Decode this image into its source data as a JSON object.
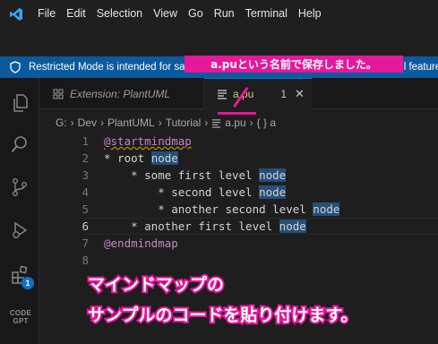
{
  "menubar": {
    "logo_icon": "vscode-logo-icon",
    "items": [
      "File",
      "Edit",
      "Selection",
      "View",
      "Go",
      "Run",
      "Terminal",
      "Help"
    ]
  },
  "restricted_banner": {
    "icon": "shield-icon",
    "text": "Restricted Mode is intended for safe code browsing. Trust this window to enable all features."
  },
  "activity_bar": {
    "items": [
      "explorer-icon",
      "search-icon",
      "source-control-icon",
      "run-debug-icon",
      "extensions-icon"
    ],
    "extensions_badge": "1",
    "codegpt_line1": "CODE",
    "codegpt_line2": "GPT"
  },
  "tabs": [
    {
      "label": "Extension: PlantUML",
      "active": false
    },
    {
      "label": "a.pu",
      "active": true,
      "problems": "1"
    }
  ],
  "breadcrumb": [
    "G:",
    "Dev",
    "PlantUML",
    "Tutorial",
    "a.pu",
    "{ } a"
  ],
  "editor": {
    "current_line": 6,
    "lines": [
      {
        "num": "1",
        "parts": [
          {
            "t": "@startmindmap",
            "c": "kw squiggle"
          }
        ]
      },
      {
        "num": "2",
        "parts": [
          {
            "t": "* root ",
            "c": ""
          },
          {
            "t": "node",
            "c": "hl"
          }
        ]
      },
      {
        "num": "3",
        "parts": [
          {
            "t": "    * some first level ",
            "c": ""
          },
          {
            "t": "node",
            "c": "hl"
          }
        ]
      },
      {
        "num": "4",
        "parts": [
          {
            "t": "        * second level ",
            "c": ""
          },
          {
            "t": "node",
            "c": "hl"
          }
        ]
      },
      {
        "num": "5",
        "parts": [
          {
            "t": "        * another second level ",
            "c": ""
          },
          {
            "t": "node",
            "c": "hl"
          }
        ]
      },
      {
        "num": "6",
        "parts": [
          {
            "t": "    * another first level ",
            "c": ""
          },
          {
            "t": "node",
            "c": "hl"
          }
        ]
      },
      {
        "num": "7",
        "parts": [
          {
            "t": "@endmindmap",
            "c": "kw"
          }
        ]
      },
      {
        "num": "8",
        "parts": []
      }
    ]
  },
  "annotations": {
    "top": "a.puという名前で保存しました。",
    "bottom_line1": "マインドマップの",
    "bottom_line2": "サンプルのコードを貼り付けます。"
  },
  "colors": {
    "accent": "#0078d4",
    "annotation_pink": "#e5179a",
    "modified_tab": "#e2c08d",
    "banner": "#0b5a9e"
  }
}
